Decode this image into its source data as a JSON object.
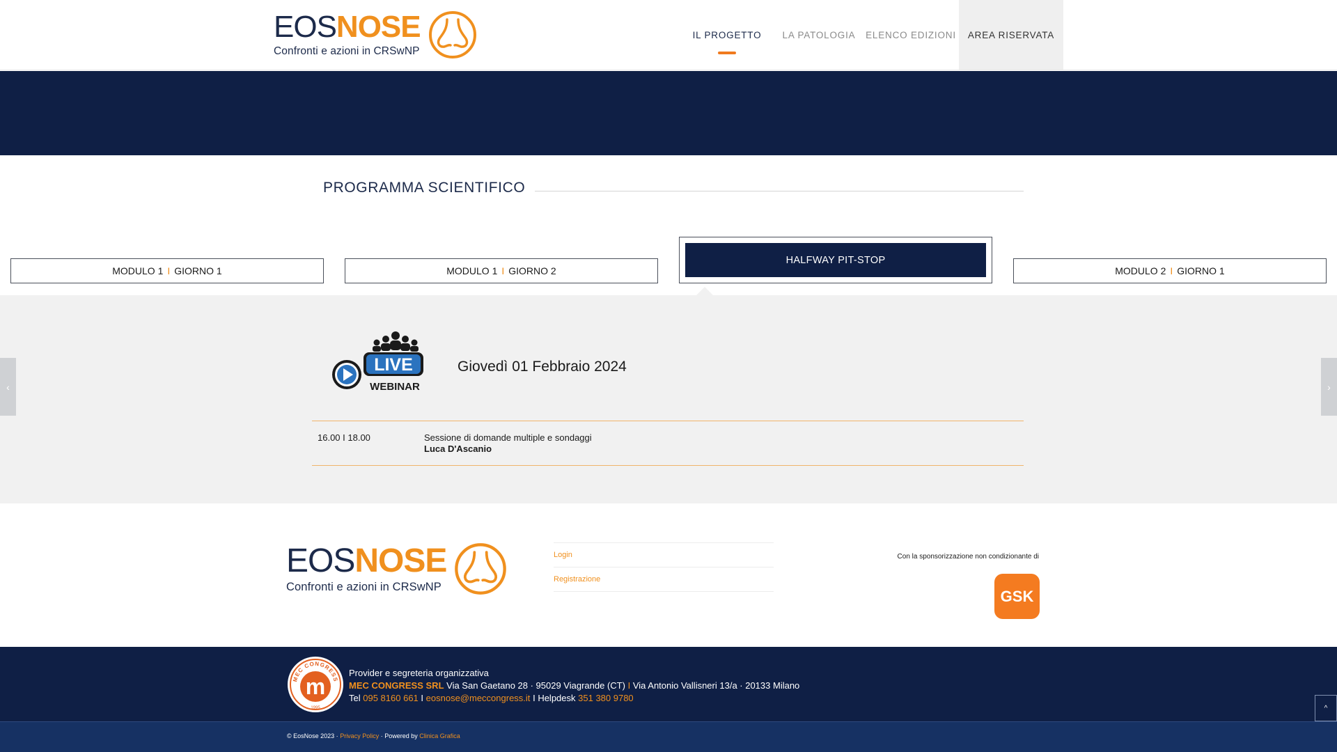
{
  "brand": {
    "word_a": "EOS",
    "word_b": "NOSE",
    "tagline": "Confronti e azioni in CRSwNP",
    "color_dark": "#1c2a4a",
    "color_orange": "#f0901e"
  },
  "nav": {
    "items": [
      {
        "label": "IL PROGETTO",
        "active": true
      },
      {
        "label": "LA PATOLOGIA",
        "active": false
      },
      {
        "label": "ELENCO EDIZIONI",
        "active": false
      },
      {
        "label": "AREA RISERVATA",
        "active": false
      }
    ]
  },
  "section": {
    "title": "PROGRAMMA SCIENTIFICO"
  },
  "tabs": [
    {
      "module": "MODULO 1",
      "sep": "I",
      "day": "GIORNO 1"
    },
    {
      "module": "MODULO 1",
      "sep": "I",
      "day": "GIORNO 2"
    },
    {
      "label": "HALFWAY PIT-STOP"
    },
    {
      "module": "MODULO 2",
      "sep": "I",
      "day": "GIORNO 1"
    }
  ],
  "event": {
    "badge_top": "LIVE",
    "badge_bottom": "WEBINAR",
    "date": "Giovedì 01 Febbraio 2024",
    "session": {
      "time": "16.00 I 18.00",
      "title": "Sessione di domande multiple e sondaggi",
      "speaker": "Luca D'Ascanio"
    }
  },
  "carousel": {
    "prev_icon": "‹",
    "next_icon": "›"
  },
  "footer_links": [
    {
      "label": "Login"
    },
    {
      "label": "Registrazione"
    }
  ],
  "sponsor": {
    "label": "Con la sponsorizzazione non condizionante di",
    "logo_text": "GSK",
    "color": "#f47b20"
  },
  "provider": {
    "heading": "Provider e segreteria organizzativa",
    "name": "MEC CONGRESS SRL",
    "address1": "Via San Gaetano 28 · 95029 Viagrande (CT)",
    "sep": "I",
    "address2": "Via Antonio Vallisneri 13/a · 20133 Milano",
    "tel_label": "Tel",
    "tel": "095 8160 661",
    "email": "eosnose@meccongress.it",
    "helpdesk_label": "Helpdesk",
    "helpdesk": "351 380 9780",
    "logo_ring_text": "MEC CONGRESS",
    "logo_year": "1995",
    "logo_letter": "m"
  },
  "copyright": {
    "text": "© EosNose 2023 ·",
    "privacy": "Privacy Policy",
    "powered": "· Powered by",
    "agency": "Clinica Grafica"
  },
  "to_top_icon": "^"
}
